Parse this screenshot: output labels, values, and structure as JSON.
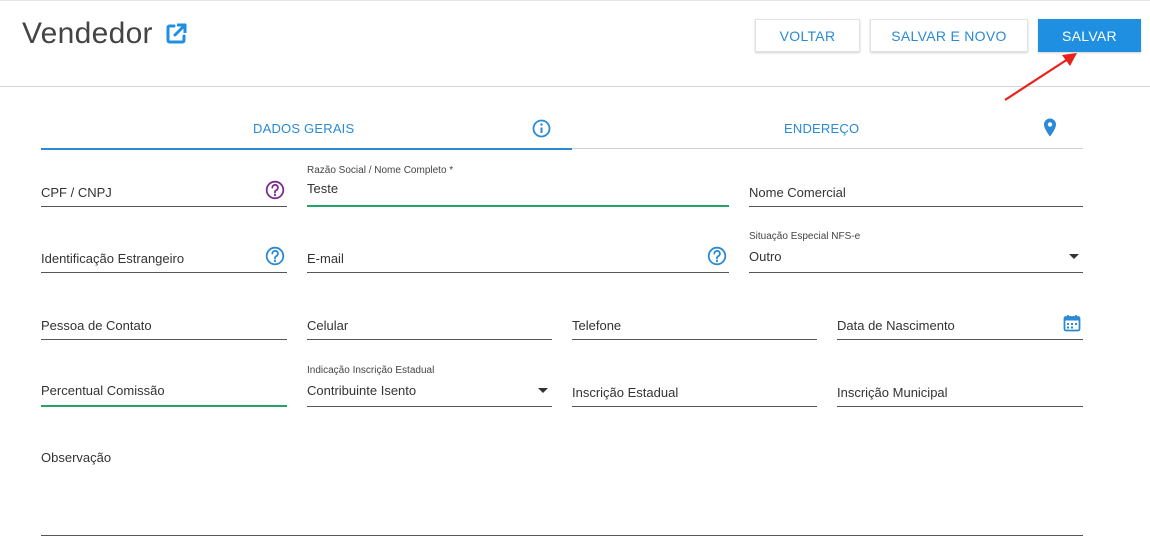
{
  "header": {
    "title": "Vendedor",
    "title_icon": "external-link-icon",
    "buttons": {
      "voltar": "VOLTAR",
      "salvar_novo": "SALVAR E NOVO",
      "salvar": "SALVAR"
    }
  },
  "tabs": [
    {
      "label": "DADOS GERAIS",
      "icon": "info-icon",
      "active": true
    },
    {
      "label": "ENDEREÇO",
      "icon": "map-pin-icon",
      "active": false
    }
  ],
  "form": {
    "cpf_cnpj": {
      "placeholder": "CPF / CNPJ",
      "icon": "help-icon"
    },
    "razao_social": {
      "label": "Razão Social / Nome Completo *",
      "value": "Teste"
    },
    "nome_comercial": {
      "placeholder": "Nome Comercial"
    },
    "identificacao_estrangeiro": {
      "placeholder": "Identificação Estrangeiro",
      "icon": "help-icon"
    },
    "email": {
      "placeholder": "E-mail",
      "icon": "help-icon"
    },
    "situacao_especial": {
      "label": "Situação Especial NFS-e",
      "value": "Outro"
    },
    "pessoa_contato": {
      "placeholder": "Pessoa de Contato"
    },
    "celular": {
      "placeholder": "Celular"
    },
    "telefone": {
      "placeholder": "Telefone"
    },
    "data_nascimento": {
      "placeholder": "Data de Nascimento",
      "icon": "calendar-icon"
    },
    "percentual_comissao": {
      "placeholder": "Percentual Comissão"
    },
    "indicacao_ie": {
      "label": "Indicação Inscrição Estadual",
      "value": "Contribuinte Isento"
    },
    "inscricao_estadual": {
      "placeholder": "Inscrição Estadual"
    },
    "inscricao_municipal": {
      "placeholder": "Inscrição Municipal"
    },
    "observacao": {
      "placeholder": "Observação"
    }
  },
  "colors": {
    "accent": "#2a8ad4",
    "primary_button": "#1e8fe1",
    "active_underline": "#26a36b",
    "help_purple": "#7b2d8e",
    "annotation_arrow": "#e8221b"
  }
}
